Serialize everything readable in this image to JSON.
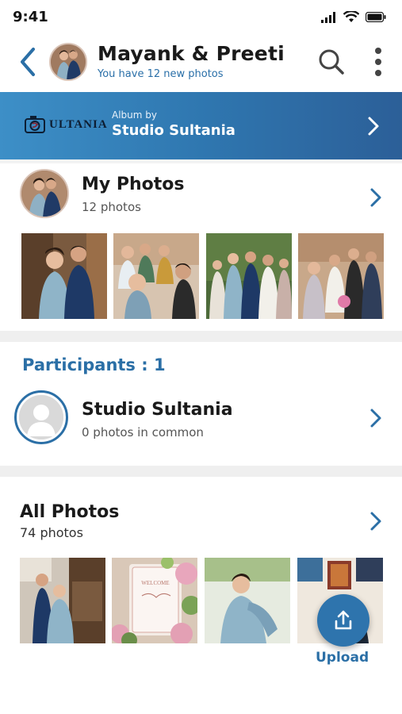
{
  "status_bar": {
    "time": "9:41"
  },
  "header": {
    "title": "Mayank & Preeti",
    "subtitle": "You have 12 new photos"
  },
  "album_banner": {
    "logo_text": "ULTANIA",
    "by_label": "Album by",
    "studio_name": "Studio Sultania"
  },
  "my_photos": {
    "title": "My Photos",
    "count": "12 photos"
  },
  "participants": {
    "title": "Participants : 1",
    "items": [
      {
        "name": "Studio Sultania",
        "common": "0 photos in common"
      }
    ]
  },
  "all_photos": {
    "title": "All Photos",
    "count": "74 photos"
  },
  "upload": {
    "label": "Upload"
  },
  "colors": {
    "accent": "#2b6fa6",
    "banner_start": "#3d8fc7",
    "banner_end": "#2c5f98",
    "divider": "#efefef"
  },
  "icons": [
    "back-chevron-icon",
    "search-icon",
    "more-vertical-icon",
    "chevron-right-icon",
    "camera-logo-icon",
    "person-placeholder-icon",
    "upload-icon",
    "signal-icon",
    "wifi-icon",
    "battery-icon"
  ]
}
